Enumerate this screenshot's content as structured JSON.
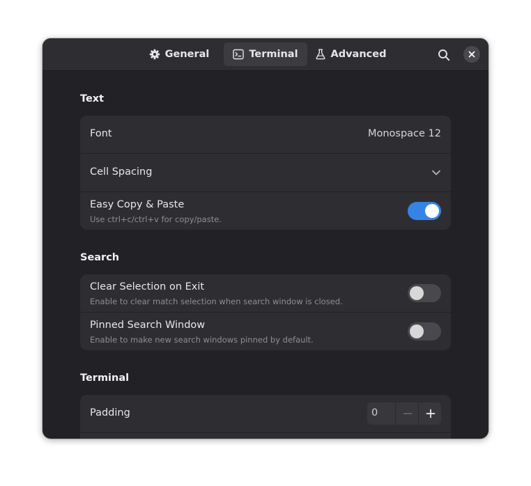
{
  "header": {
    "tabs": [
      {
        "label": "General",
        "icon": "gear-icon"
      },
      {
        "label": "Terminal",
        "icon": "terminal-icon",
        "active": true
      },
      {
        "label": "Advanced",
        "icon": "flask-icon"
      }
    ],
    "search_icon": "search-icon",
    "close_icon": "close-icon"
  },
  "sections": {
    "text": {
      "title": "Text",
      "font": {
        "label": "Font",
        "value": "Monospace 12"
      },
      "cell_spacing": {
        "label": "Cell Spacing"
      },
      "easy_copy": {
        "label": "Easy Copy & Paste",
        "subtitle": "Use ctrl+c/ctrl+v for copy/paste.",
        "enabled": true
      }
    },
    "search": {
      "title": "Search",
      "clear_selection": {
        "label": "Clear Selection on Exit",
        "subtitle": "Enable to clear match selection when search window is closed.",
        "enabled": false
      },
      "pinned_window": {
        "label": "Pinned Search Window",
        "subtitle": "Enable to make new search windows pinned by default.",
        "enabled": false
      }
    },
    "terminal": {
      "title": "Terminal",
      "padding": {
        "label": "Padding",
        "value": "0"
      }
    }
  },
  "colors": {
    "accent": "#3584e4",
    "window_bg": "#222226",
    "card_bg": "#2e2e32"
  }
}
